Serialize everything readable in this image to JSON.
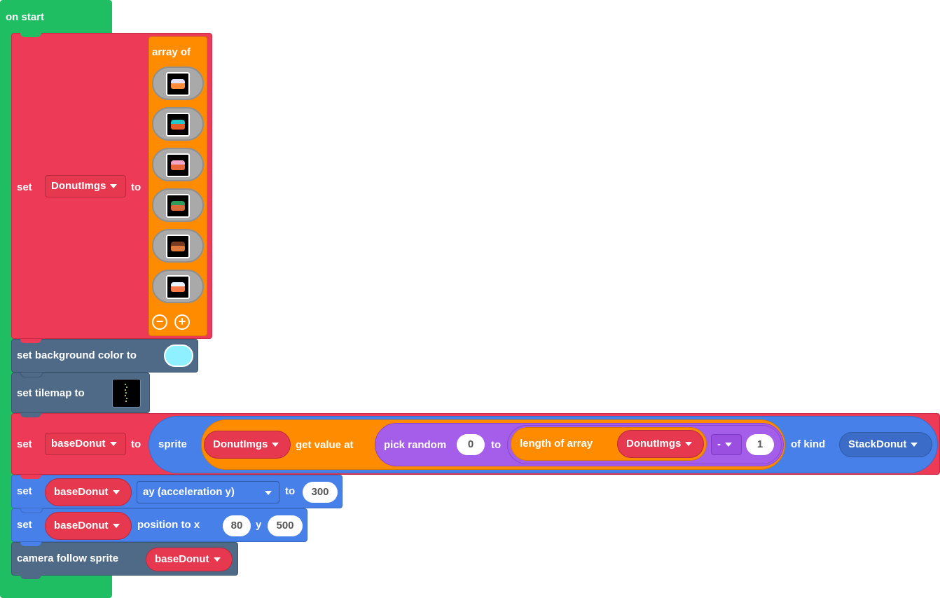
{
  "on_start": {
    "label": "on start"
  },
  "set_array": {
    "set_label": "set",
    "variable": "DonutImgs",
    "to_label": "to",
    "array_label": "array of",
    "images": [
      {
        "name": "donut-purple",
        "icing": "#e0e0ff",
        "base": "#ff8c3a"
      },
      {
        "name": "donut-teal",
        "icing": "#23c7c7",
        "base": "#e85c2a"
      },
      {
        "name": "donut-pink",
        "icing": "#f4a6c8",
        "base": "#e8683a"
      },
      {
        "name": "donut-green",
        "icing": "#2f9a5a",
        "base": "#d86a3a"
      },
      {
        "name": "donut-chocolate",
        "icing": "#7a3b1f",
        "base": "#e07a3a"
      },
      {
        "name": "donut-blue-white",
        "icing": "#e8f4ff",
        "base": "#ff7a4a"
      }
    ]
  },
  "bg_color": {
    "label": "set background color to",
    "color": "#8ff0ff"
  },
  "tilemap": {
    "label": "set tilemap to"
  },
  "base_donut": {
    "set_label": "set",
    "variable": "baseDonut",
    "to_label": "to",
    "sprite_label": "sprite",
    "array_var": "DonutImgs",
    "get_value_label": "get value at",
    "pick_random_label": "pick random",
    "random_min": "0",
    "random_to_label": "to",
    "length_label": "length of array",
    "length_var": "DonutImgs",
    "operator": "-",
    "operand": "1",
    "of_kind_label": "of kind",
    "kind": "StackDonut"
  },
  "set_ay": {
    "set_label": "set",
    "variable": "baseDonut",
    "property": "ay (acceleration y)",
    "to_label": "to",
    "value": "300"
  },
  "set_position": {
    "set_label": "set",
    "variable": "baseDonut",
    "position_label": "position to x",
    "x": "80",
    "y_label": "y",
    "y": "500"
  },
  "camera": {
    "label": "camera follow sprite",
    "variable": "baseDonut"
  },
  "colors": {
    "event": "#1fbe63",
    "variables": "#ed3a57",
    "scene": "#4e6a87",
    "sprites": "#4680e8",
    "arrays": "#ff8c00",
    "math": "#a55eea"
  }
}
